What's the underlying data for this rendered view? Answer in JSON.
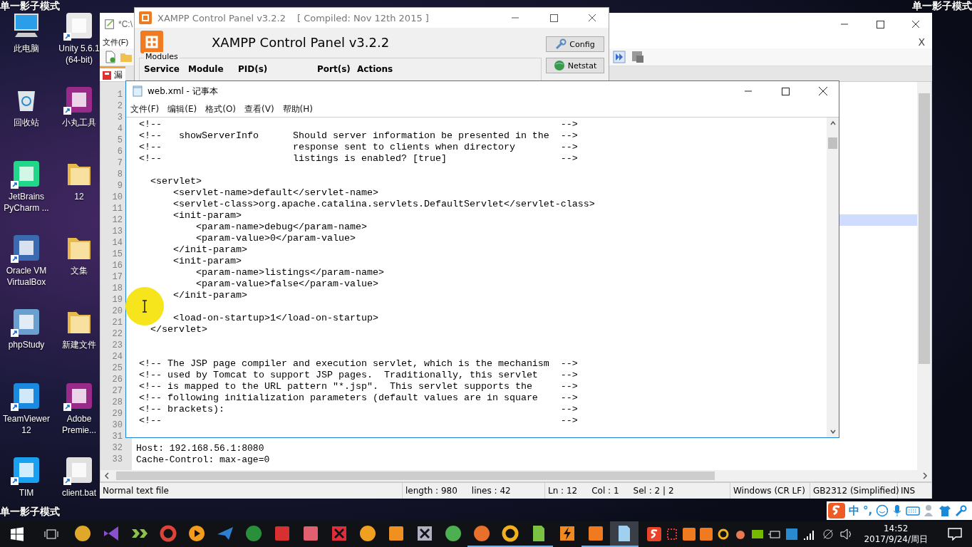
{
  "overlay_labels": [
    "单一影子模式",
    "单一影子模式",
    "单一影子模式"
  ],
  "desktop_icons": [
    {
      "label": "此电脑",
      "kind": "computer",
      "shortcut": false
    },
    {
      "label": "Unity 5.6.1\n(64-bit)",
      "kind": "cube",
      "shortcut": true
    },
    {
      "label": "回收站",
      "kind": "bin",
      "shortcut": false
    },
    {
      "label": "小丸工具",
      "kind": "tile",
      "shortcut": true
    },
    {
      "label": "JetBrains\nPyCharm ...",
      "kind": "ide",
      "shortcut": true
    },
    {
      "label": "12",
      "kind": "folder",
      "shortcut": false
    },
    {
      "label": "Oracle VM\nVirtualBox",
      "kind": "box",
      "shortcut": true
    },
    {
      "label": "文集",
      "kind": "folder",
      "shortcut": false
    },
    {
      "label": "phpStudy",
      "kind": "monitor",
      "shortcut": true
    },
    {
      "label": "新建文件",
      "kind": "folder",
      "shortcut": false
    },
    {
      "label": "TeamViewer\n12",
      "kind": "arrows",
      "shortcut": true
    },
    {
      "label": "Adobe\nPremie...",
      "kind": "tile",
      "shortcut": true
    },
    {
      "label": "TIM",
      "kind": "star",
      "shortcut": true
    },
    {
      "label": "client.bat",
      "kind": "gears",
      "shortcut": true
    }
  ],
  "editor_window": {
    "title": "*C:\\",
    "menu": [
      "文件(F)"
    ],
    "doc_close": "X",
    "tab": "漏",
    "line_numbers": [
      {
        "n": "1",
        "current": false
      },
      {
        "n": "2",
        "current": false
      },
      {
        "n": "3",
        "current": false
      },
      {
        "n": "4",
        "current": false
      },
      {
        "n": "5",
        "current": false
      },
      {
        "n": "6",
        "current": false
      },
      {
        "n": "7",
        "current": false
      },
      {
        "n": "8",
        "current": false
      },
      {
        "n": "9",
        "current": false
      },
      {
        "n": "10",
        "current": false
      },
      {
        "n": "11",
        "current": false
      },
      {
        "n": "12",
        "current": true
      },
      {
        "n": "13",
        "current": false
      },
      {
        "n": "14",
        "current": false
      },
      {
        "n": "15",
        "current": false
      },
      {
        "n": "16",
        "current": false
      },
      {
        "n": "17",
        "current": false
      },
      {
        "n": "18",
        "current": false
      },
      {
        "n": "19",
        "current": false
      },
      {
        "n": "20",
        "current": false
      },
      {
        "n": "21",
        "current": false
      },
      {
        "n": "22",
        "current": false
      },
      {
        "n": "23",
        "current": false
      },
      {
        "n": "24",
        "current": false
      },
      {
        "n": "25",
        "current": false
      },
      {
        "n": "26",
        "current": false
      },
      {
        "n": "27",
        "current": false
      },
      {
        "n": "28",
        "current": false
      },
      {
        "n": "29",
        "current": false
      },
      {
        "n": "30",
        "current": false
      },
      {
        "n": "31",
        "current": false
      },
      {
        "n": "32",
        "current": false
      },
      {
        "n": "33",
        "current": false
      }
    ],
    "tail_lines": [
      "Host: 192.168.56.1:8080",
      "Cache-Control: max-age=0"
    ],
    "status_bar": [
      {
        "parts": [
          "Normal text file"
        ]
      },
      {
        "parts": [
          "length : 980",
          "lines : 42"
        ]
      },
      {
        "parts": [
          "Ln : 12",
          "Col : 1",
          "Sel : 2 | 2"
        ]
      },
      {
        "parts": [
          "Windows (CR LF)"
        ]
      },
      {
        "parts": [
          "GB2312 (Simplified)"
        ]
      },
      {
        "parts": [
          "INS"
        ]
      }
    ]
  },
  "xampp_window": {
    "title": "XAMPP Control Panel v3.2.2",
    "compiled": "[ Compiled: Nov 12th 2015 ]",
    "heading": "XAMPP Control Panel v3.2.2",
    "buttons": [
      {
        "label": "Config",
        "kind": "wrench"
      },
      {
        "label": "Netstat",
        "kind": "globe"
      }
    ],
    "group_label": "Modules",
    "columns": [
      "Service",
      "Module",
      "PID(s)",
      "Port(s)",
      "Actions"
    ]
  },
  "notepad_window": {
    "title": "web.xml - 记事本",
    "menu": [
      "文件(F)",
      "编辑(E)",
      "格式(O)",
      "查看(V)",
      "帮助(H)"
    ],
    "blocks": [
      {
        "kind": "gap",
        "lines": [
          "<!--                                                                      -->",
          "<!--   showServerInfo      Should server information be presented in the  -->",
          "<!--                       response sent to clients when directory        -->",
          "<!--                       listings is enabled? [true]                    -->"
        ]
      },
      {
        "kind": "gap",
        "lines": [
          "  <servlet>",
          "      <servlet-name>default</servlet-name>",
          "      <servlet-class>org.apache.catalina.servlets.DefaultServlet</servlet-class>",
          "      <init-param>",
          "          <param-name>debug</param-name>",
          "          <param-value>0</param-value>",
          "      </init-param>",
          "      <init-param>",
          "          <param-name>listings</param-name>",
          "          <param-value>false</param-value>",
          "      </init-param>"
        ]
      },
      {
        "kind": "wide_gap",
        "lines": [
          "      <load-on-startup>1</load-on-startup>",
          "  </servlet>"
        ]
      },
      {
        "kind": "end",
        "lines": [
          "<!-- The JSP page compiler and execution servlet, which is the mechanism  -->",
          "<!-- used by Tomcat to support JSP pages.  Traditionally, this servlet    -->",
          "<!-- is mapped to the URL pattern \"*.jsp\".  This servlet supports the     -->",
          "<!-- following initialization parameters (default values are in square    -->",
          "<!-- brackets):                                                           -->",
          "<!--                                                                      -->"
        ]
      }
    ]
  },
  "ime_bar": {
    "mode": "中",
    "punct": "°,"
  },
  "taskbar": {
    "apps": [
      {
        "running": false,
        "selected": false
      },
      {
        "running": false,
        "selected": false
      },
      {
        "running": false,
        "selected": false
      },
      {
        "running": false,
        "selected": false
      },
      {
        "running": false,
        "selected": false
      },
      {
        "running": false,
        "selected": false
      },
      {
        "running": false,
        "selected": false
      },
      {
        "running": false,
        "selected": false
      },
      {
        "running": false,
        "selected": false
      },
      {
        "running": false,
        "selected": false
      },
      {
        "running": false,
        "selected": false
      },
      {
        "running": false,
        "selected": false
      },
      {
        "running": false,
        "selected": false
      },
      {
        "running": false,
        "selected": false
      },
      {
        "running": true,
        "selected": false
      },
      {
        "running": true,
        "selected": false
      },
      {
        "running": true,
        "selected": false
      },
      {
        "running": false,
        "selected": false
      },
      {
        "running": true,
        "selected": false
      },
      {
        "running": true,
        "selected": true
      }
    ],
    "time": "14:52",
    "date": "2017/9/24/周日"
  }
}
